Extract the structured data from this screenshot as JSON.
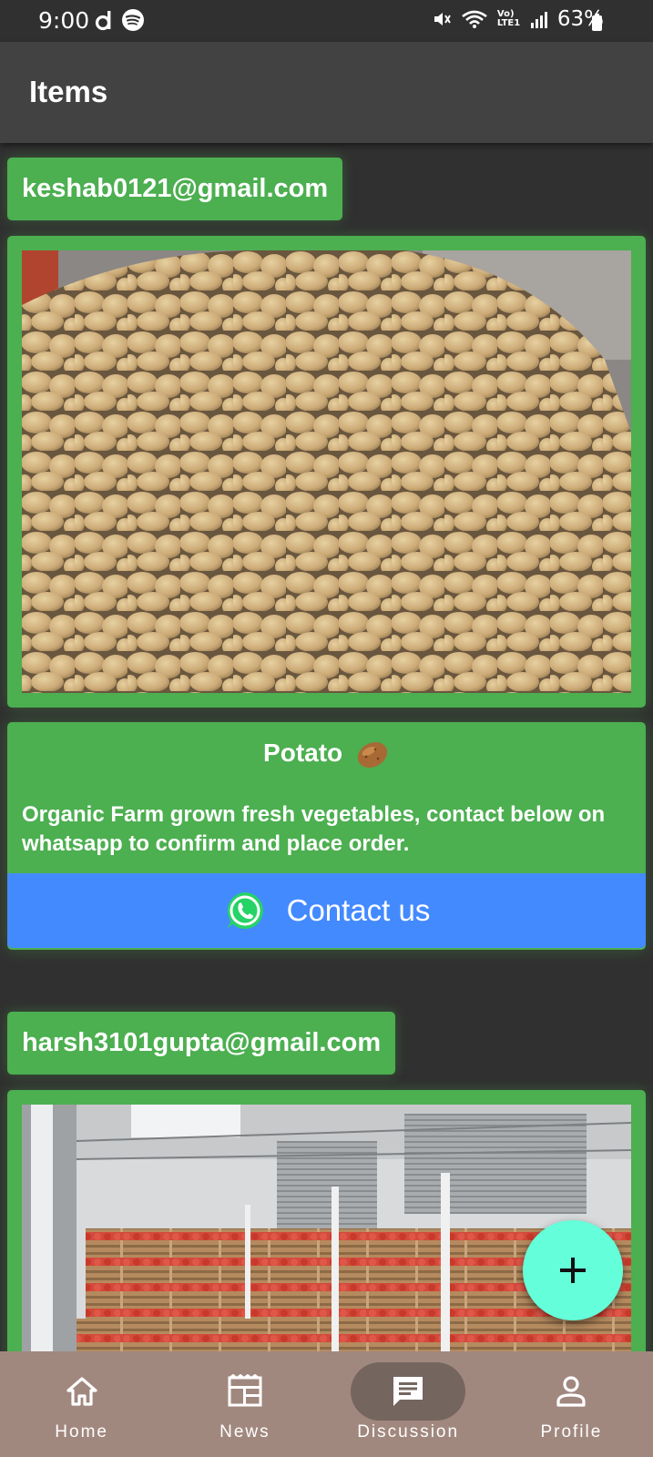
{
  "status_bar": {
    "time": "9:00",
    "network_label": "Vo) LTE1",
    "battery": "63%",
    "icons": [
      "d-app-icon",
      "spotify-icon",
      "mute-icon",
      "wifi-icon",
      "signal-icon",
      "battery-icon"
    ]
  },
  "app_bar": {
    "title": "Items"
  },
  "posts": [
    {
      "email": "keshab0121@gmail.com",
      "image": "potato-pile-photo",
      "name": "Potato",
      "name_emoji_icon": "potato-icon",
      "description": "Organic Farm grown fresh vegetables, contact below on whatsapp to confirm and place order.",
      "contact_label": "Contact us",
      "contact_icon": "whatsapp-icon"
    },
    {
      "email": "harsh3101gupta@gmail.com",
      "image": "tomato-crates-warehouse-photo"
    }
  ],
  "fab": {
    "icon": "plus-icon"
  },
  "bottom_nav": {
    "items": [
      {
        "label": "Home",
        "icon": "home-icon",
        "active": false
      },
      {
        "label": "News",
        "icon": "news-icon",
        "active": false
      },
      {
        "label": "Discussion",
        "icon": "chat-icon",
        "active": true
      },
      {
        "label": "Profile",
        "icon": "profile-icon",
        "active": false
      }
    ]
  },
  "colors": {
    "background": "#303030",
    "app_bar": "#424242",
    "card_green": "#4caf50",
    "contact_blue": "#448aff",
    "fab_teal": "#64ffda",
    "nav_bar": "#a1887f",
    "nav_active": "#75655f"
  }
}
